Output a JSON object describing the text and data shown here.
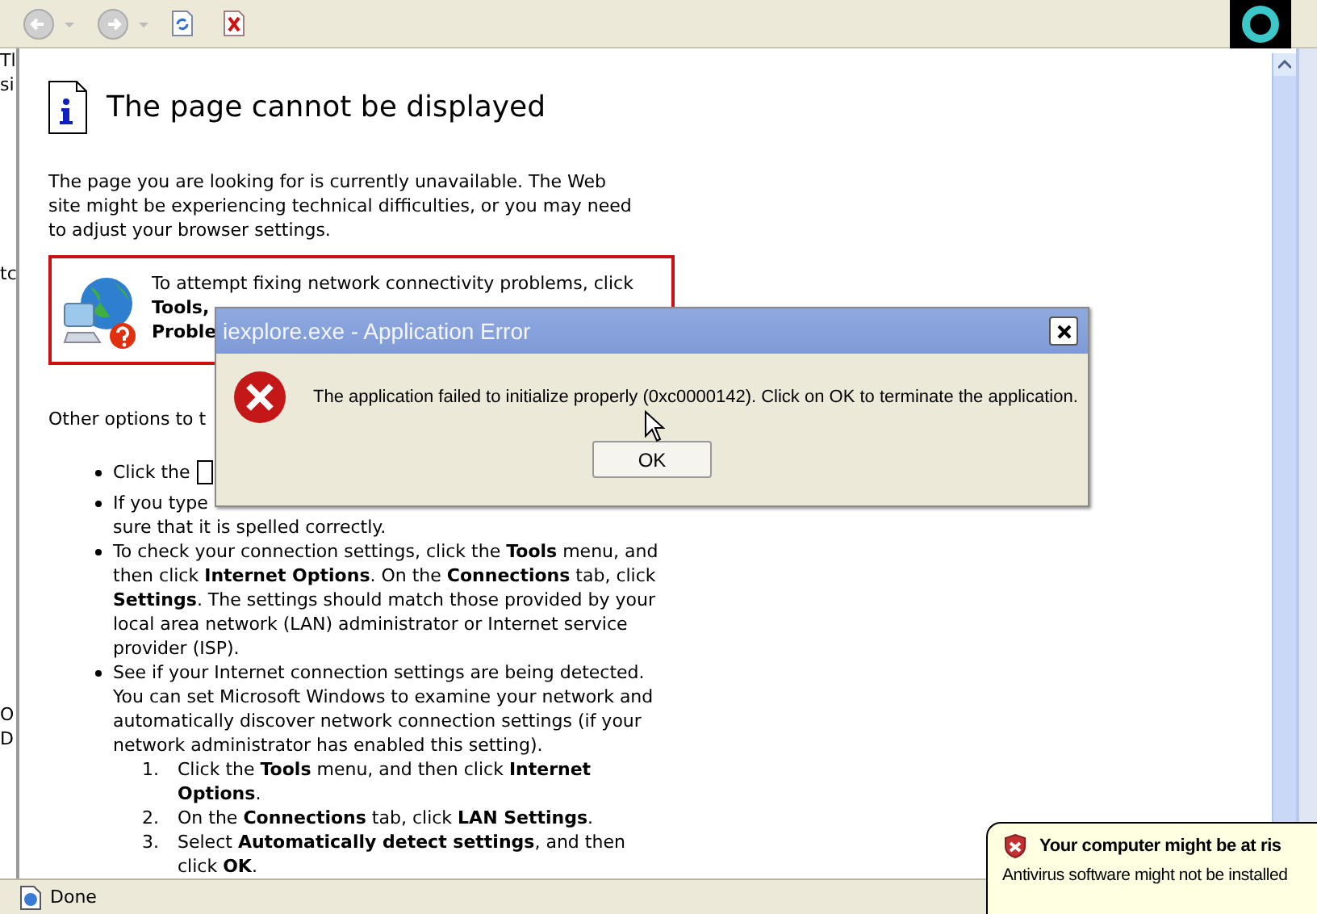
{
  "background_window": {
    "texts": [
      "Tl",
      "si",
      "tc",
      "O",
      "D"
    ]
  },
  "page": {
    "title": "The page cannot be displayed",
    "intro": "The page you are looking for is currently unavailable. The Web site might be experiencing technical difficulties, or you may need to adjust your browser settings.",
    "tip_lines": [
      "To attempt fixing network connectivity problems, click",
      "**Tools,**",
      "**Proble**"
    ],
    "options_heading": "Other options to t",
    "options": [
      {
        "kind": "button-hint",
        "text": "Click the"
      },
      {
        "kind": "covered",
        "text": "If you type",
        "text_2": "sure that it is spelled correctly."
      },
      {
        "kind": "plain",
        "text": "To check your connection settings, click the **Tools** menu, and then click **Internet Options**. On the **Connections** tab, click **Settings**. The settings should match those provided by your local area network (LAN) administrator or Internet service provider (ISP)."
      },
      {
        "kind": "plain",
        "text": "See if your Internet connection settings are being detected. You can set Microsoft Windows to examine your network and automatically discover network connection settings (if your network administrator has enabled this setting).",
        "children": [
          {
            "number": "1.",
            "text": "Click the **Tools** menu, and then click **Internet Options**."
          },
          {
            "number": "2.",
            "text": "On the **Connections** tab, click **LAN Settings**."
          },
          {
            "number": "3.",
            "text": "Select **Automatically detect settings**, and then click **OK**."
          }
        ]
      }
    ]
  },
  "status_bar": {
    "text": "Done"
  },
  "dialog": {
    "title": "iexplore.exe - Application Error",
    "message": "The application failed to initialize properly (0xc0000142). Click on OK to terminate the application.",
    "buttons": [
      "OK"
    ]
  },
  "balloon": {
    "title": "Your computer might be at ris",
    "text": "Antivirus software might not be installed"
  }
}
